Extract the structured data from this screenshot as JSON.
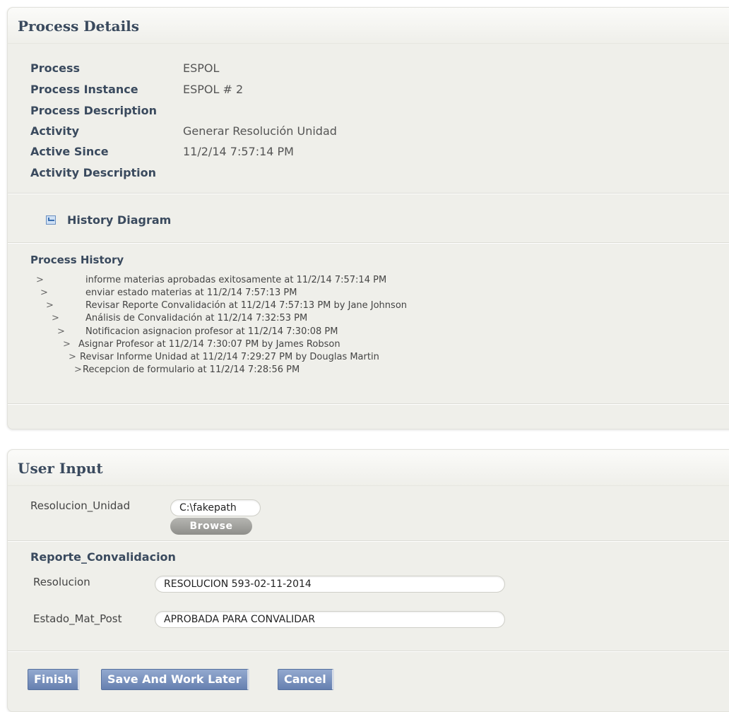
{
  "process_details": {
    "header": "Process Details",
    "fields": [
      {
        "label": "Process",
        "value": "ESPOL"
      },
      {
        "label": "Process Instance",
        "value": "ESPOL # 2"
      },
      {
        "label": "Process Description",
        "value": ""
      },
      {
        "label": "Activity",
        "value": "Generar Resolución Unidad"
      },
      {
        "label": "Active Since",
        "value": "11/2/14 7:57:14 PM"
      },
      {
        "label": "Activity Description",
        "value": ""
      }
    ],
    "history_diagram_label": "History Diagram",
    "history_diagram_icon": "diagram-icon",
    "process_history_title": "Process History",
    "history": [
      {
        "arrow": ">",
        "text": "informe materias aprobadas exitosamente at 11/2/14 7:57:14 PM"
      },
      {
        "arrow": ">",
        "text": "enviar estado materias at 11/2/14 7:57:13 PM"
      },
      {
        "arrow": ">",
        "text": "Revisar Reporte Convalidación at 11/2/14 7:57:13 PM by Jane Johnson"
      },
      {
        "arrow": ">",
        "text": "Análisis de Convalidación at 11/2/14 7:32:53 PM"
      },
      {
        "arrow": ">",
        "text": "Notificacion asignacion profesor at 11/2/14 7:30:08 PM"
      },
      {
        "arrow": ">",
        "text": "Asignar Profesor at 11/2/14 7:30:07 PM by James Robson"
      },
      {
        "arrow": ">",
        "text": "Revisar Informe Unidad at 11/2/14 7:29:27 PM by Douglas Martin"
      },
      {
        "arrow": ">",
        "text": "Recepcion de formulario at 11/2/14 7:28:56 PM"
      }
    ]
  },
  "user_input": {
    "header": "User Input",
    "resolucion_unidad_label": "Resolucion_Unidad",
    "resolucion_unidad_value": "C:\\fakepath",
    "browse_label": "Browse",
    "reporte_title": "Reporte_Convalidacion",
    "resolucion_label": "Resolucion",
    "resolucion_value": "RESOLUCION 593-02-11-2014",
    "estado_label": "Estado_Mat_Post",
    "estado_value": "APROBADA PARA CONVALIDAR",
    "buttons": {
      "finish": "Finish",
      "save_later": "Save And Work Later",
      "cancel": "Cancel"
    }
  }
}
